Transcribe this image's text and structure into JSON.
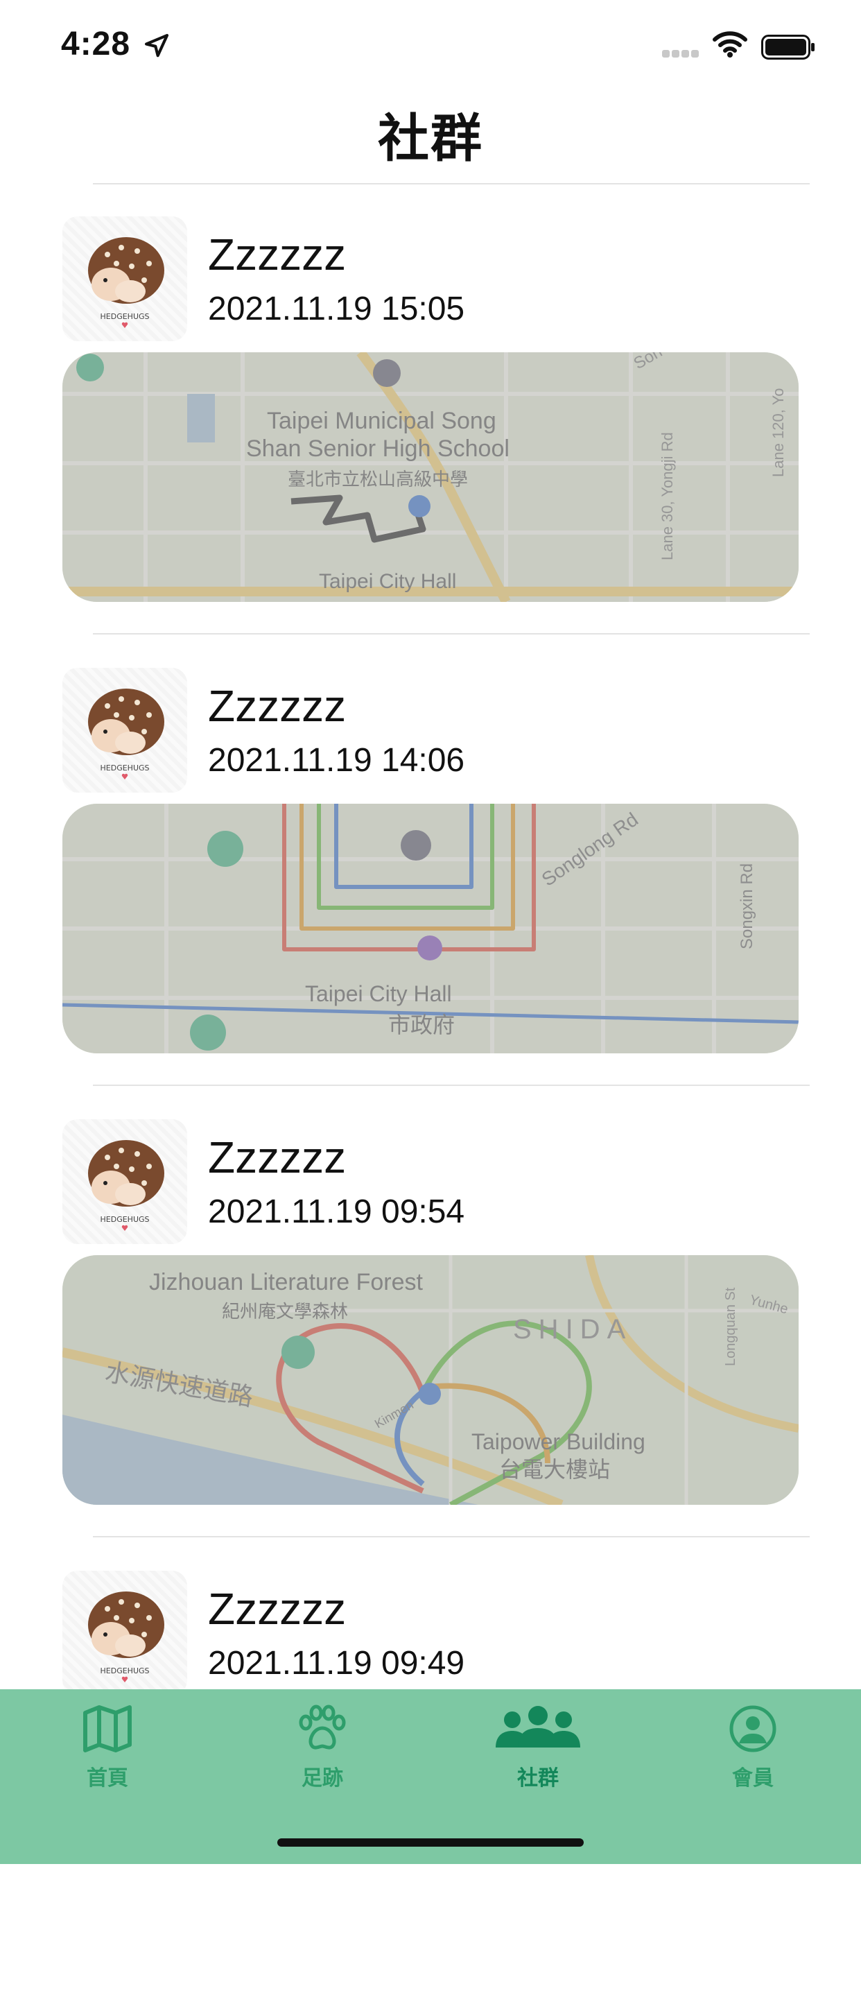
{
  "status_bar": {
    "time": "4:28"
  },
  "header": {
    "title": "社群"
  },
  "posts": [
    {
      "user": "Zzzzzz",
      "date": "2021.11.19 15:05",
      "map_labels": [
        "Taipei Municipal Song",
        "Shan Senior High School",
        "臺北市立松山高級中學",
        "Taipei City Hall",
        "Lane 30, Yongji Rd",
        "Lane 120, Yo",
        "Son"
      ]
    },
    {
      "user": "Zzzzzz",
      "date": "2021.11.19 14:06",
      "map_labels": [
        "Songlong Rd",
        "Songxin Rd",
        "Taipei City Hall",
        "市政府"
      ]
    },
    {
      "user": "Zzzzzz",
      "date": "2021.11.19 09:54",
      "map_labels": [
        "Jizhouan Literature Forest",
        "紀州庵文學森林",
        "SHIDA",
        "Longquan St",
        "Yunhe",
        "水源快速道路",
        "Taipower Building",
        "台電大樓站",
        "Kinmen"
      ]
    },
    {
      "user": "Zzzzzz",
      "date": "2021.11.19 09:49"
    }
  ],
  "tabbar": {
    "items": [
      {
        "label": "首頁",
        "icon": "map-icon"
      },
      {
        "label": "足跡",
        "icon": "paw-icon"
      },
      {
        "label": "社群",
        "icon": "people-icon"
      },
      {
        "label": "會員",
        "icon": "person-circle-icon"
      }
    ],
    "active": "社群"
  },
  "colors": {
    "tabbar_bg": "#7dc8a3",
    "tab_icon": "#2e9e6b",
    "tab_active": "#13875a"
  }
}
